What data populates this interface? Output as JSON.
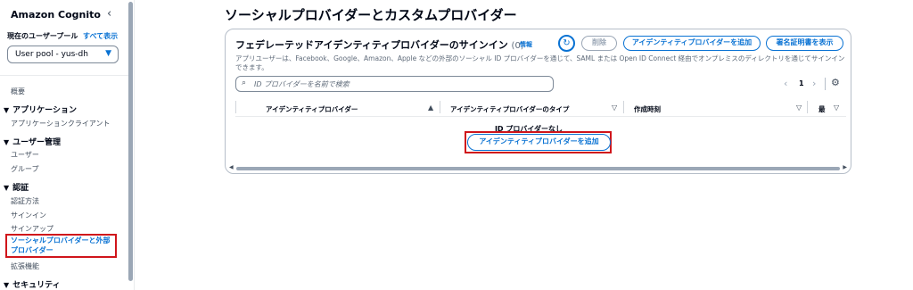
{
  "sidebar": {
    "title": "Amazon Cognito",
    "collapse_icon": "chevron-left-icon",
    "pool_label": "現在のユーザープール",
    "show_all": "すべて表示",
    "pool_value": "User pool - yus-dh",
    "overview": "概要",
    "sections": [
      {
        "label": "アプリケーション",
        "items": [
          "アプリケーションクライアント"
        ]
      },
      {
        "label": "ユーザー管理",
        "items": [
          "ユーザー",
          "グループ"
        ]
      },
      {
        "label": "認証",
        "items": [
          "認証方法",
          "サインイン",
          "サインアップ",
          "ソーシャルプロバイダーと外部プロバイダー",
          "拡張機能"
        ]
      },
      {
        "label": "セキュリティ",
        "items": []
      }
    ]
  },
  "main": {
    "page_title": "ソーシャルプロバイダーとカスタムプロバイダー",
    "card": {
      "title": "フェデレーテッドアイデンティティプロバイダーのサインイン",
      "count": "(0)",
      "info": "情報",
      "delete_label": "削除",
      "add_label": "アイデンティティプロバイダーを追加",
      "cert_label": "署名証明書を表示",
      "description": "アプリユーザーは、Facebook、Google、Amazon、Apple などの外部のソーシャル ID プロバイダーを通じて、SAML または Open ID Connect 経由でオンプレミスのディレクトリを通じてサインインできます。",
      "search_placeholder": "ID プロバイダーを名前で検索",
      "page_number": "1",
      "columns": [
        "アイデンティティプロバイダー",
        "アイデンティティプロバイダーのタイプ",
        "作成時刻",
        "最"
      ],
      "empty_text": "ID プロバイダーなし",
      "empty_button": "アイデンティティプロバイダーを追加"
    }
  },
  "colors": {
    "accent": "#0972d3",
    "highlight": "#d0151b"
  }
}
